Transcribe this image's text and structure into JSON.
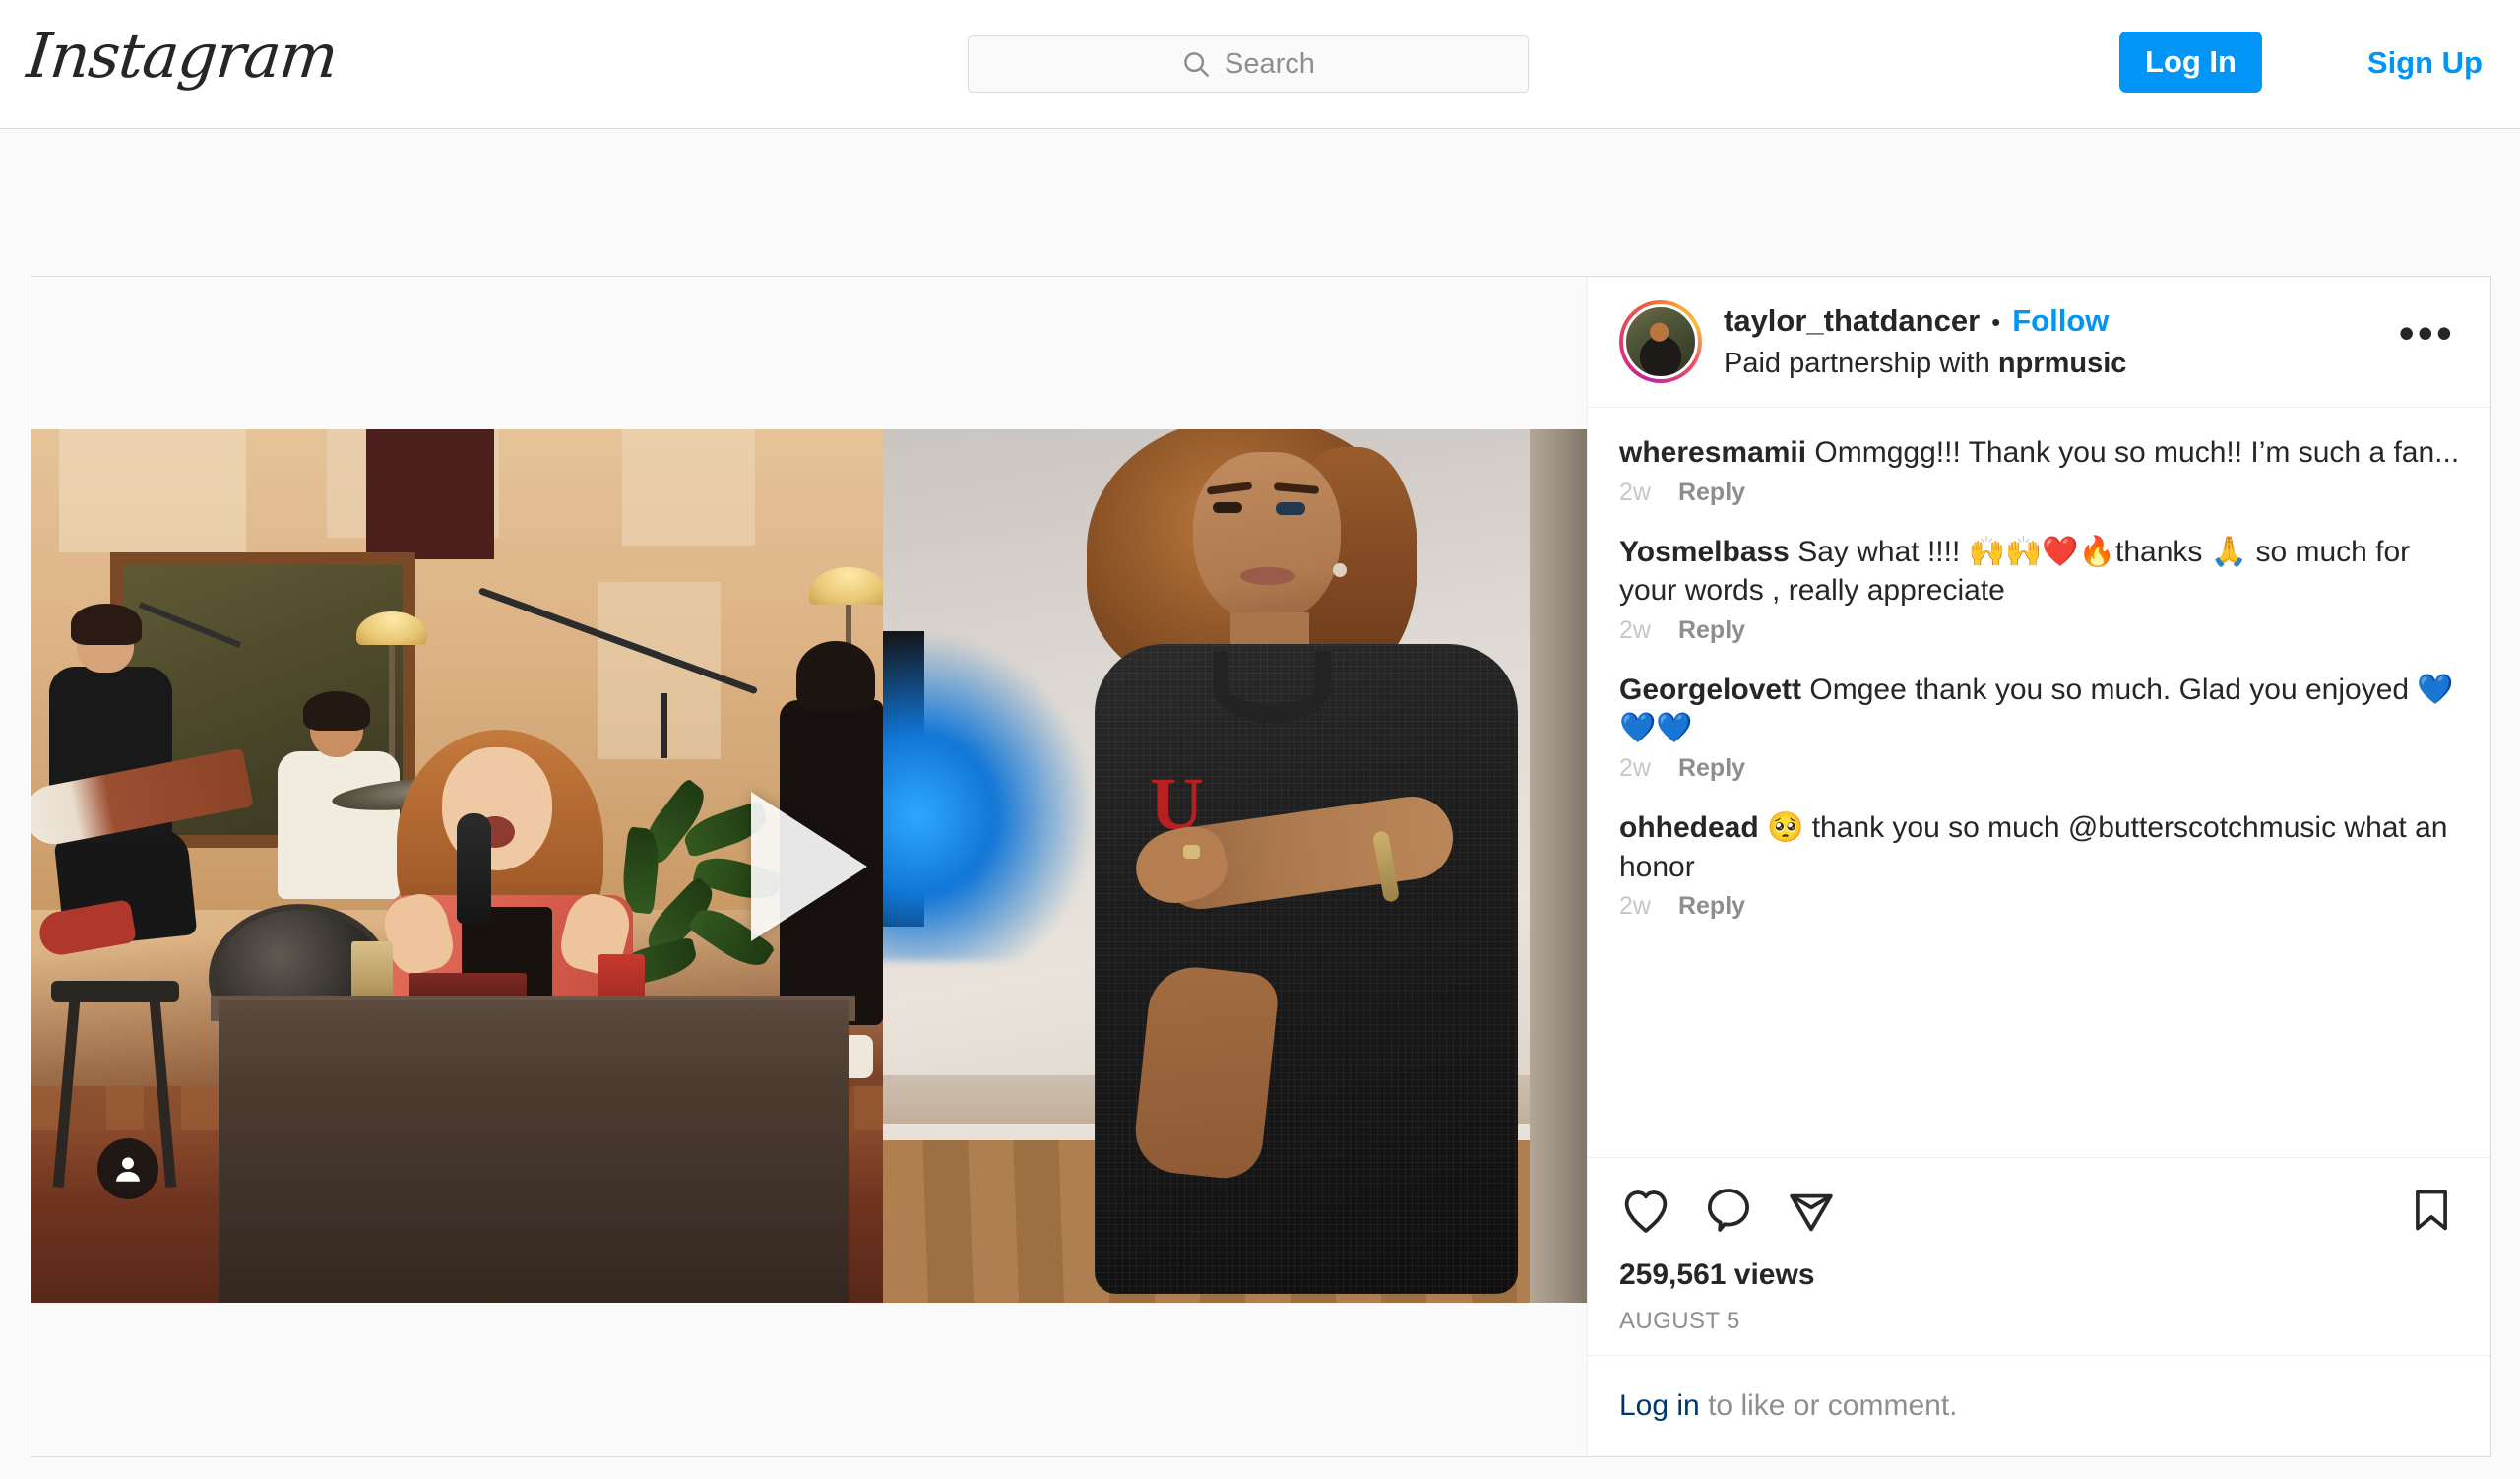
{
  "header": {
    "brand": "Instagram",
    "search": {
      "placeholder": "Search",
      "value": "",
      "icon": "search-icon"
    },
    "login_label": "Log In",
    "signup_label": "Sign Up",
    "accent_color": "#0095f6"
  },
  "post": {
    "author": {
      "username": "taylor_thatdancer",
      "separator": "•",
      "follow_label": "Follow",
      "paid_prefix": "Paid partnership with ",
      "paid_brand": "nprmusic"
    },
    "more_options_label": "•••",
    "media": {
      "type": "video",
      "play_icon": "play-icon",
      "tag_icon": "person-tag-icon",
      "left_scene": "band performing in warm-lit living room, singer at table with microphone",
      "right_scene": "dancer in black mesh jersey with red U logo, blue accent light"
    },
    "comments": [
      {
        "user": "wheresmamii",
        "text": " Ommggg!!! Thank you so much!! I’m such a fan...",
        "time": "2w",
        "reply_label": "Reply"
      },
      {
        "user": "Yosmelbass",
        "text": " Say what !!!! 🙌🙌❤️🔥thanks 🙏 so much for your words , really appreciate",
        "time": "2w",
        "reply_label": "Reply"
      },
      {
        "user": "Georgelovett",
        "text": " Omgee thank you so much. Glad you enjoyed 💙💙💙",
        "time": "2w",
        "reply_label": "Reply"
      },
      {
        "user": "ohhedead",
        "text": " 🥺 thank you so much @butterscotchmusic what an honor",
        "time": "2w",
        "reply_label": "Reply"
      }
    ],
    "actions": {
      "like_icon": "heart-icon",
      "comment_icon": "comment-bubble-icon",
      "share_icon": "share-paper-plane-icon",
      "save_icon": "bookmark-icon"
    },
    "views": "259,561 views",
    "date": "AUGUST 5",
    "footer": {
      "login_link": "Log in",
      "rest": " to like or comment."
    }
  }
}
